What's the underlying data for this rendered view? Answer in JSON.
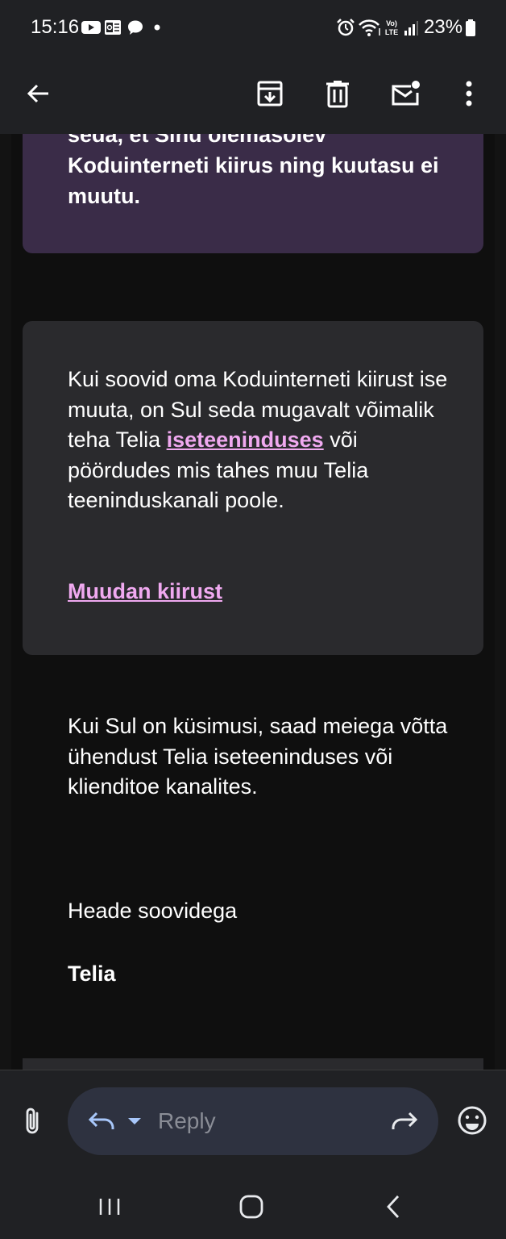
{
  "status_bar": {
    "time": "15:16",
    "battery": "23%",
    "icons": [
      "youtube-icon",
      "outlook-icon",
      "chat-bubble-icon",
      "dot-icon",
      "alarm-icon",
      "wifi-icon",
      "volte-icon",
      "signal-icon",
      "battery-icon"
    ]
  },
  "toolbar": {
    "icons": [
      "back-arrow-icon",
      "archive-icon",
      "delete-icon",
      "mark-unread-icon",
      "more-vert-icon"
    ]
  },
  "email": {
    "purple_card_text": "seda, et Sinu olemasolev Koduinterneti kiirus ning kuutasu ei muutu.",
    "gray_card": {
      "text_before_link": "Kui soovid oma Koduinterneti kiirust ise muuta, on Sul seda mugavalt võimalik teha Telia ",
      "link_text": "iseteeninduses",
      "text_after_link": " või pöördudes mis tahes muu Telia teeninduskanali poole.",
      "cta_link": "Muudan kiirust "
    },
    "contact_text": "Kui Sul on küsimusi, saad meiega võtta ühendust Telia iseteeninduses või klienditoe kanalites.",
    "closing": "Heade soovidega",
    "signature": "Telia"
  },
  "reply_bar": {
    "placeholder": "Reply",
    "icons": [
      "attachment-icon",
      "reply-icon",
      "dropdown-icon",
      "forward-icon",
      "emoji-icon"
    ]
  },
  "nav_bar": {
    "icons": [
      "recents-icon",
      "home-icon",
      "back-icon"
    ]
  },
  "colors": {
    "background": "#131313",
    "bar": "#202124",
    "purple_card": "#3a2c48",
    "gray_card": "#2a2a2d",
    "link": "#f0a9f0",
    "reply_pill": "#2e3240"
  }
}
